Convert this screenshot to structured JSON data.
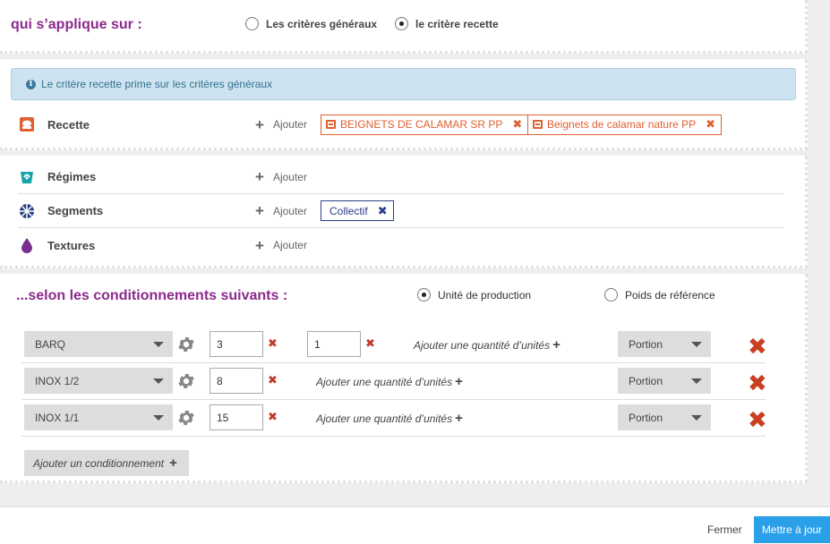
{
  "applies_section": {
    "title": "qui s’applique sur :",
    "options": [
      {
        "label": "Les critères généraux",
        "selected": false
      },
      {
        "label": "le critère recette",
        "selected": true
      }
    ]
  },
  "info_message": "Le critère recette prime sur les critères généraux",
  "add_label": "Ajouter",
  "criteria": {
    "recette": {
      "label": "Recette",
      "tags": [
        "BEIGNETS DE CALAMAR SR PP",
        "Beignets de calamar nature PP"
      ]
    },
    "regimes": {
      "label": "Régimes"
    },
    "segments": {
      "label": "Segments",
      "tags": [
        "Collectif"
      ]
    },
    "textures": {
      "label": "Textures"
    }
  },
  "conditioning": {
    "title": "...selon les conditionnements suivants :",
    "options": [
      {
        "label": "Unité de production",
        "selected": true
      },
      {
        "label": "Poids de référence",
        "selected": false
      }
    ],
    "add_quantity_label": "Ajouter une quantité d’unités",
    "rows": [
      {
        "container": "BARQ",
        "qty": "3",
        "qty2": "1",
        "unit": "Portion"
      },
      {
        "container": "INOX 1/2",
        "qty": "8",
        "unit": "Portion"
      },
      {
        "container": "INOX 1/1",
        "qty": "15",
        "unit": "Portion"
      }
    ],
    "add_button": "Ajouter un conditionnement"
  },
  "footer": {
    "close": "Fermer",
    "update": "Mettre à jour"
  },
  "colors": {
    "purple": "#8b2a8b",
    "accent_orange": "#e06030",
    "tag_blue": "#2a3f88",
    "update_blue": "#2aa0e8",
    "delete_red": "#c8401f"
  }
}
